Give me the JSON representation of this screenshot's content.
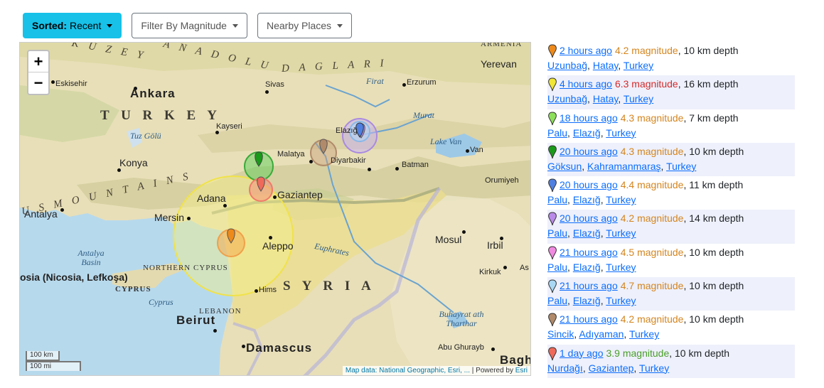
{
  "toolbar": {
    "sorted_prefix": "Sorted:",
    "sorted_value": "Recent",
    "filter_label": "Filter By Magnitude",
    "nearby_label": "Nearby Places"
  },
  "map": {
    "zoom_in": "+",
    "zoom_out": "−",
    "scale_km": "100 km",
    "scale_mi": "100 mi",
    "attribution_prefix": "Map data:",
    "attribution_source": "National Geographic, Esri, ...",
    "attribution_powered": "| Powered by",
    "attribution_esri": "Esri",
    "labels": {
      "kuzey": "K U Z E Y",
      "anadolu": "A N A D O L U",
      "daglari": "D A G L A R I",
      "turkey": "T U R K E Y",
      "taurus": "U S   M O U N T A I N S",
      "syria": "S Y R I A",
      "ankara": "Ankara",
      "eskisehir": "Eskisehir",
      "sivas": "Sivas",
      "erzurum": "Erzurum",
      "yerevan": "Yerevan",
      "armenia": "ARMENIA",
      "kayseri": "Kayseri",
      "tuz_golu": "Tuz Gölü",
      "konya": "Konya",
      "malatya": "Malatya",
      "elazig": "Elazığ",
      "diyarbakir": "Diyarbakir",
      "batman": "Batman",
      "lake_van": "Lake Van",
      "van": "Van",
      "firat": "Firat",
      "murat": "Murat",
      "adana": "Adana",
      "gaziantep": "Gaziantep",
      "antalya": "Antalya",
      "mersin": "Mersin",
      "oruniyeh": "Orumiyeh",
      "mosul": "Mosul",
      "irbil": "Irbil",
      "aleppo": "Aleppo",
      "euphrates": "Euphrates",
      "kirkuk": "Kirkuk",
      "as": "As",
      "nicosia": "osia (Nicosia, Lefkoşa)",
      "northern_cyprus": "NORTHERN CYPRUS",
      "cyprus_caps": "CYPRUS",
      "cyprus": "Cyprus",
      "antalya_basin": "Antalya Basin",
      "homs": "Hims",
      "lebanon": "LEBANON",
      "beirut": "Beirut",
      "damascus": "Damascus",
      "buhayrat": "Buhayrat ath Tharthar",
      "abu_ghurayb": "Abu Ghurayb",
      "baghdad": "Bagh"
    }
  },
  "earthquakes": [
    {
      "color": "#ee8a1a",
      "time": "2 hours ago",
      "mag_text": "4.2 magnitude",
      "mag_color": "#d4851f",
      "depth": ", 10 km depth",
      "places": [
        "Uzunbağ",
        "Hatay",
        "Turkey"
      ]
    },
    {
      "color": "#f0e635",
      "time": "4 hours ago",
      "mag_text": "6.3 magnitude",
      "mag_color": "#d22b2b",
      "depth": ", 16 km depth",
      "places": [
        "Uzunbağ",
        "Hatay",
        "Turkey"
      ]
    },
    {
      "color": "#8de05a",
      "time": "18 hours ago",
      "mag_text": "4.3 magnitude",
      "mag_color": "#d4851f",
      "depth": ", 7 km depth",
      "places": [
        "Palu",
        "Elazığ",
        "Turkey"
      ]
    },
    {
      "color": "#1a9a1a",
      "time": "20 hours ago",
      "mag_text": "4.3 magnitude",
      "mag_color": "#d4851f",
      "depth": ", 10 km depth",
      "places": [
        "Göksun",
        "Kahramanmaraş",
        "Turkey"
      ]
    },
    {
      "color": "#4f7fe0",
      "time": "20 hours ago",
      "mag_text": "4.4 magnitude",
      "mag_color": "#d4851f",
      "depth": ", 11 km depth",
      "places": [
        "Palu",
        "Elazığ",
        "Turkey"
      ]
    },
    {
      "color": "#b98ae8",
      "time": "20 hours ago",
      "mag_text": "4.2 magnitude",
      "mag_color": "#d4851f",
      "depth": ", 14 km depth",
      "places": [
        "Palu",
        "Elazığ",
        "Turkey"
      ]
    },
    {
      "color": "#f08ae0",
      "time": "21 hours ago",
      "mag_text": "4.5 magnitude",
      "mag_color": "#d4851f",
      "depth": ", 10 km depth",
      "places": [
        "Palu",
        "Elazığ",
        "Turkey"
      ]
    },
    {
      "color": "#a9d8f5",
      "time": "21 hours ago",
      "mag_text": "4.7 magnitude",
      "mag_color": "#d4851f",
      "depth": ", 10 km depth",
      "places": [
        "Palu",
        "Elazığ",
        "Turkey"
      ]
    },
    {
      "color": "#b08a6a",
      "time": "21 hours ago",
      "mag_text": "4.2 magnitude",
      "mag_color": "#d4851f",
      "depth": ", 10 km depth",
      "places": [
        "Sincik",
        "Adıyaman",
        "Turkey"
      ]
    },
    {
      "color": "#ef6a5a",
      "time": "1 day ago",
      "mag_text": "3.9 magnitude",
      "mag_color": "#4a9e2a",
      "depth": ", 10 km depth",
      "places": [
        "Nurdağı",
        "Gaziantep",
        "Turkey"
      ]
    }
  ]
}
